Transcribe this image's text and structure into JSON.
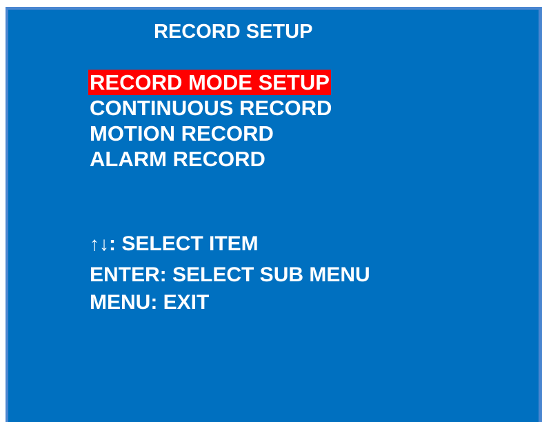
{
  "screen": {
    "title": "RECORD SETUP",
    "menu_items": [
      {
        "label": "RECORD MODE SETUP",
        "selected": true
      },
      {
        "label": "CONTINUOUS RECORD",
        "selected": false
      },
      {
        "label": "MOTION RECORD",
        "selected": false
      },
      {
        "label": "ALARM RECORD",
        "selected": false
      }
    ],
    "help": {
      "select_icons": "↑↓",
      "select_text": ": SELECT ITEM",
      "enter_text": "ENTER: SELECT SUB MENU",
      "menu_text": "MENU: EXIT"
    }
  },
  "colors": {
    "background": "#0070c0",
    "border": "#4a86d0",
    "highlight": "#ff0000",
    "text": "#ffffff"
  }
}
